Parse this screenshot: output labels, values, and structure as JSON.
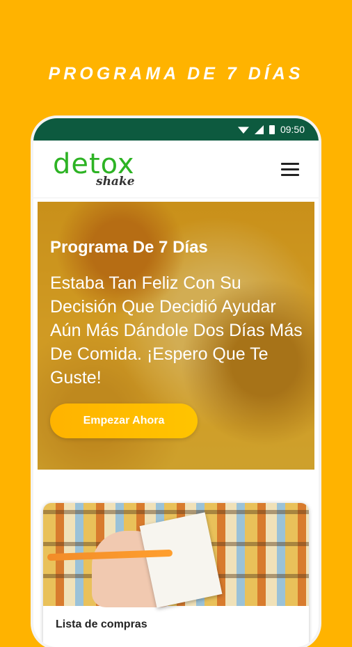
{
  "promo": {
    "title": "PROGRAMA DE 7 DÍAS"
  },
  "status_bar": {
    "time": "09:50"
  },
  "app": {
    "logo_main": "detox",
    "logo_sub": "shake"
  },
  "hero": {
    "title": "Programa De 7 Días",
    "text": "Estaba Tan Feliz Con Su Decisión Que Decidió Ayudar Aún Más Dándole Dos Días Más De Comida. ¡Espero Que Te Guste!",
    "cta_label": "Empezar Ahora"
  },
  "card": {
    "title": "Lista de compras"
  },
  "colors": {
    "background": "#FFB300",
    "status_bar": "#0D5A3F",
    "logo_green": "#2DB324",
    "cta": "#FFB300"
  },
  "icons": [
    "wifi-icon",
    "signal-icon",
    "battery-icon",
    "menu-icon"
  ]
}
